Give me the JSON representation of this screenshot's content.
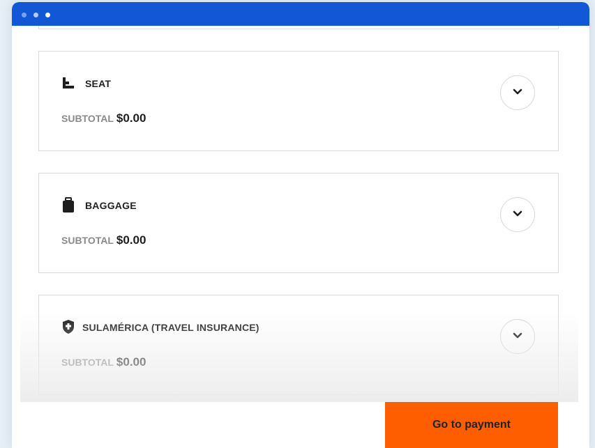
{
  "window": {
    "titlebar_color": "#1157d6",
    "accent_color": "#ff5e00"
  },
  "cards": [
    {
      "title": "SEAT",
      "icon": "seat-icon",
      "subtotal_label": "SUBTOTAL",
      "subtotal_value": "$0.00",
      "expand_icon": "chevron-down-icon"
    },
    {
      "title": "BAGGAGE",
      "icon": "suitcase-icon",
      "subtotal_label": "SUBTOTAL",
      "subtotal_value": "$0.00",
      "expand_icon": "chevron-down-icon"
    },
    {
      "title": "SULAMÉRICA (TRAVEL INSURANCE)",
      "icon": "shield-icon",
      "subtotal_label": "SUBTOTAL",
      "subtotal_value": "$0.00",
      "expand_icon": "chevron-down-icon"
    }
  ],
  "footer": {
    "pay_label": "Go to payment"
  }
}
